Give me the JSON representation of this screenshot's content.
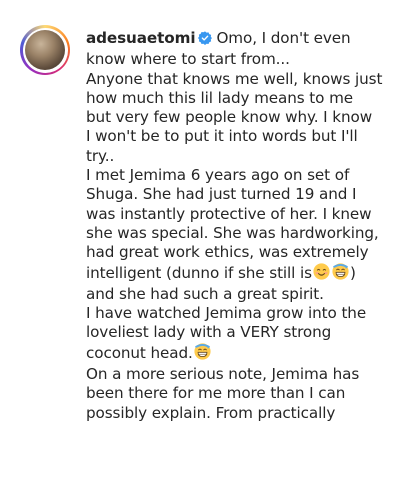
{
  "post": {
    "username": "adesuaetomi",
    "verified_icon": "verified-badge-icon",
    "caption_first_line_after_name": "Omo, I don't even",
    "caption_lines": [
      "know where to start from...",
      "Anyone that knows me well, knows just",
      "how much this lil lady means to me",
      "but very few people know why. I know",
      "I won't be to put it into words but I'll",
      "try..",
      "I met Jemima 6 years ago on set of",
      "Shuga. She had just turned 19 and I",
      "was instantly protective of her. I knew",
      "she was special. She was hardworking,",
      "had great work ethics, was extremely"
    ],
    "line_intelligent_text": "intelligent (dunno if she still is",
    "line_intelligent_end": ")",
    "caption_lines_2": [
      "and she had such a great spirit.",
      "I have watched Jemima grow into the",
      "loveliest lady with a VERY strong"
    ],
    "line_coconut_text": "coconut head.",
    "caption_lines_3": [
      "On a more serious note, Jemima has",
      "been there for me more than I can",
      "possibly explain. From practically"
    ],
    "emojis": [
      "smiling-face-icon",
      "grinning-sweat-face-icon",
      "grinning-sweat-face-icon"
    ],
    "colors": {
      "text": "#262626",
      "verified_blue": "#3897f0",
      "background": "#ffffff"
    }
  }
}
